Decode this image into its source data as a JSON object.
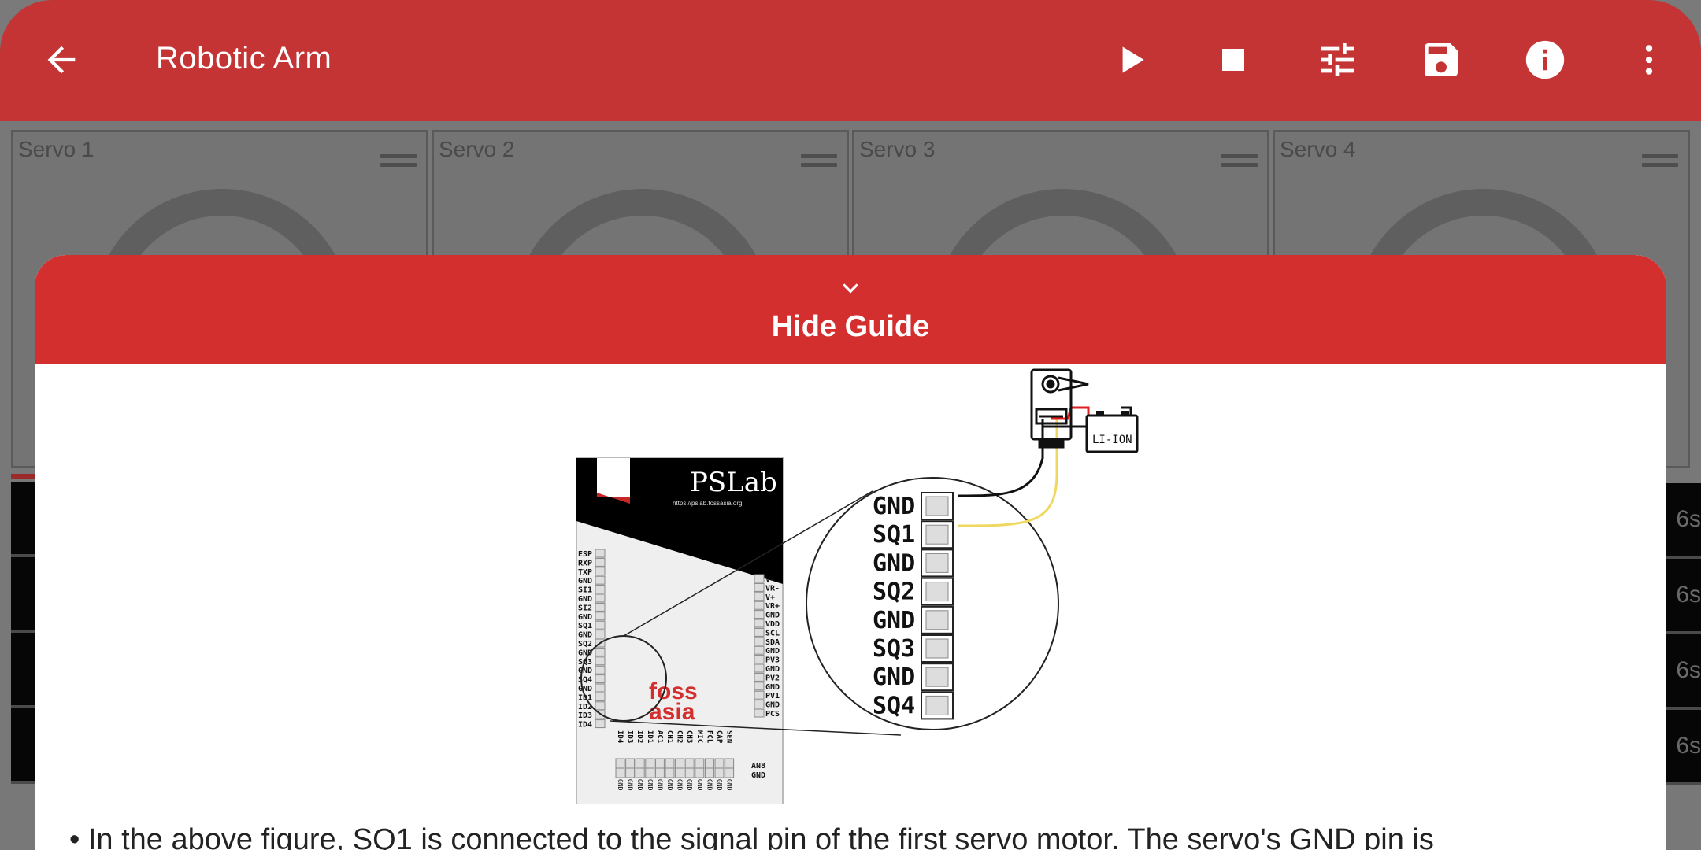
{
  "appbar": {
    "title": "Robotic Arm",
    "icons": [
      "back-arrow-icon",
      "play-icon",
      "stop-icon",
      "tune-icon",
      "save-icon",
      "info-icon",
      "more-vert-icon"
    ]
  },
  "servos": [
    {
      "label": "Servo 1"
    },
    {
      "label": "Servo 2"
    },
    {
      "label": "Servo 3"
    },
    {
      "label": "Servo 4"
    }
  ],
  "timeline": {
    "row_labels": [
      "6s",
      "6s",
      "6s",
      "6s"
    ]
  },
  "guide": {
    "hide_label": "Hide Guide",
    "text": "• In the above figure, SQ1 is connected to the signal pin of the first servo motor. The servo's GND pin is",
    "board": {
      "brand": "PSLab",
      "url": "https://pslab.fossasia.org",
      "logo_line1": "foss",
      "logo_line2": "asia",
      "left_pins": [
        "ESP",
        "RXP",
        "TXP",
        "GND",
        "SI1",
        "GND",
        "SI2",
        "GND",
        "SQ1",
        "GND",
        "SQ2",
        "GND",
        "SQ3",
        "GND",
        "SQ4",
        "GND",
        "ID1",
        "ID2",
        "ID3",
        "ID4"
      ],
      "right_pins": [
        "V-",
        "VR-",
        "V+",
        "VR+",
        "GND",
        "VDD",
        "SCL",
        "SDA",
        "GND",
        "PV3",
        "GND",
        "PV2",
        "GND",
        "PV1",
        "GND",
        "PCS"
      ],
      "bottom_pins": [
        "ID4",
        "ID3",
        "ID2",
        "ID1",
        "AC1",
        "CH1",
        "CH2",
        "CH3",
        "MIC",
        "FCL",
        "CAP",
        "SEN"
      ],
      "bottom_right": [
        "AN8",
        "GND"
      ]
    },
    "zoom_pins": [
      "GND",
      "SQ1",
      "GND",
      "SQ2",
      "GND",
      "SQ3",
      "GND",
      "SQ4"
    ],
    "battery_label": "LI-ION",
    "colors": {
      "signal_wire": "#f0d860",
      "power_wire": "#e02020",
      "ground_wire": "#111111",
      "accent": "#d32f2f"
    }
  }
}
